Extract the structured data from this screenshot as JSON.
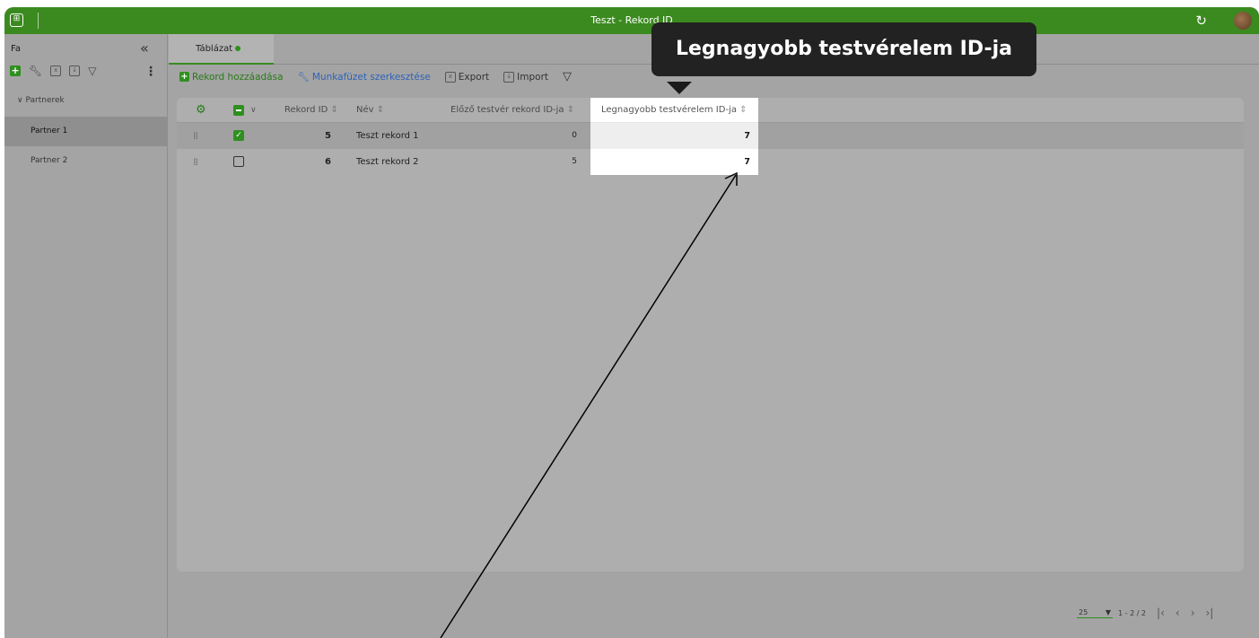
{
  "window": {
    "title": "Teszt - Rekord ID",
    "apps_icon": "apps-icon",
    "refresh_icon": "refresh-icon"
  },
  "sidebar": {
    "title": "Fa",
    "collapse_glyph": "«",
    "tools": [
      "add-icon",
      "wrench-icon",
      "export-icon",
      "import-icon",
      "filter-icon",
      "more-icon"
    ],
    "group": {
      "label": "Partnerek"
    },
    "items": [
      {
        "label": "Partner 1",
        "active": true
      },
      {
        "label": "Partner 2",
        "active": false
      }
    ]
  },
  "tabs": [
    {
      "label": "Táblázat",
      "active": true
    }
  ],
  "toolbar": {
    "add_record": "Rekord hozzáadása",
    "edit_workbook": "Munkafüzet szerkesztése",
    "export": "Export",
    "import": "Import"
  },
  "table": {
    "columns": {
      "record_id": "Rekord ID",
      "name": "Név",
      "prev_sibling": "Előző testvér rekord ID-ja",
      "max_sibling": "Legnagyobb testvérelem ID-ja"
    },
    "rows": [
      {
        "checked": true,
        "record_id": "5",
        "name": "Teszt rekord 1",
        "prev_sibling": "0",
        "max_sibling": "7"
      },
      {
        "checked": false,
        "record_id": "6",
        "name": "Teszt rekord 2",
        "prev_sibling": "5",
        "max_sibling": "7"
      }
    ]
  },
  "tooltip": {
    "text": "Legnagyobb testvérelem ID-ja"
  },
  "pager": {
    "page_size": "25",
    "range": "1 - 2 / 2"
  },
  "colors": {
    "accent": "#3b8a1f",
    "link": "#2e62b8",
    "overlay": "#a4a4a4"
  }
}
